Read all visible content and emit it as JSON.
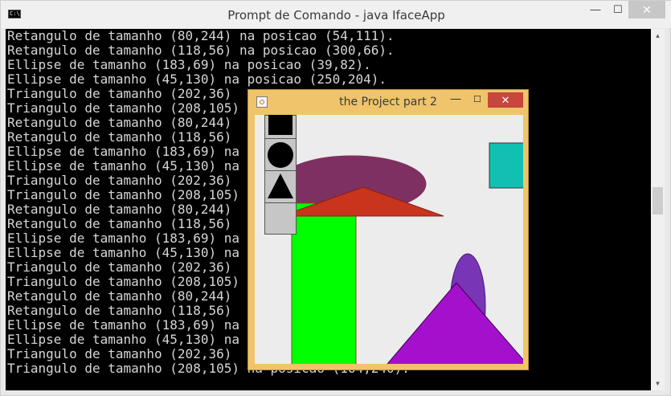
{
  "cmd_window": {
    "title": "Prompt de Comando - java  IfaceApp",
    "icon": "cmd-icon",
    "icon_text": "C:\\",
    "min_symbol": "—",
    "max_symbol": "☐",
    "close_symbol": "✕"
  },
  "console": {
    "lines": [
      "Retangulo de tamanho (80,244) na posicao (54,111).",
      "Retangulo de tamanho (118,56) na posicao (300,66).",
      "Ellipse de tamanho (183,69) na posicao (39,82).",
      "Ellipse de tamanho (45,130) na posicao (250,204).",
      "Triangulo de tamanho (202,36)",
      "Triangulo de tamanho (208,105)",
      "Retangulo de tamanho (80,244)",
      "Retangulo de tamanho (118,56)",
      "Ellipse de tamanho (183,69) na",
      "Ellipse de tamanho (45,130) na",
      "Triangulo de tamanho (202,36)",
      "Triangulo de tamanho (208,105)",
      "Retangulo de tamanho (80,244)",
      "Retangulo de tamanho (118,56)",
      "Ellipse de tamanho (183,69) na",
      "Ellipse de tamanho (45,130) na",
      "Triangulo de tamanho (202,36)",
      "Triangulo de tamanho (208,105)",
      "Retangulo de tamanho (80,244)",
      "Retangulo de tamanho (118,56)",
      "Ellipse de tamanho (183,69) na",
      "Ellipse de tamanho (45,130) na",
      "Triangulo de tamanho (202,36)",
      "Triangulo de tamanho (208,105) na posicao (164,240)."
    ],
    "text_color": "#d6d6d6",
    "background": "#000000"
  },
  "scrollbar": {
    "up_symbol": "▲",
    "down_symbol": "▼"
  },
  "java_window": {
    "title": "the Project part 2",
    "icon": "java-icon",
    "min_symbol": "—",
    "max_symbol": "☐",
    "close_symbol": "✕",
    "frame_color": "#efc46a",
    "close_color": "#c7463e"
  },
  "toolbox": {
    "tools": [
      {
        "name": "rectangle-tool",
        "icon": "square-icon"
      },
      {
        "name": "ellipse-tool",
        "icon": "circle-icon"
      },
      {
        "name": "triangle-tool",
        "icon": "triangle-icon"
      },
      {
        "name": "empty-tool",
        "icon": ""
      }
    ]
  },
  "shapes": [
    {
      "kind": "ellipse",
      "name": "purple-ellipse",
      "fill": "#7f3062"
    },
    {
      "kind": "rectangle",
      "name": "green-rectangle",
      "fill": "#00ff00"
    },
    {
      "kind": "triangle",
      "name": "red-triangle",
      "fill": "#c8341c"
    },
    {
      "kind": "rectangle",
      "name": "teal-rectangle",
      "fill": "#12c0b2"
    },
    {
      "kind": "ellipse",
      "name": "violet-ellipse",
      "fill": "#7835b5"
    },
    {
      "kind": "triangle",
      "name": "magenta-triangle",
      "fill": "#a410cc"
    }
  ]
}
